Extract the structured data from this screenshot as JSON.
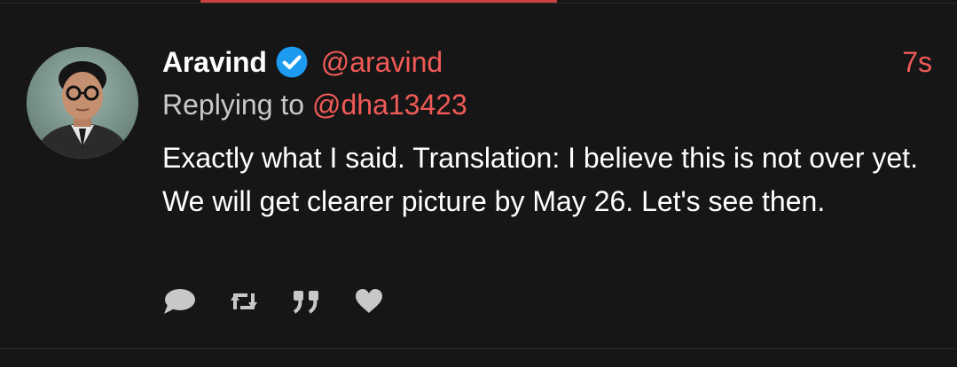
{
  "tweet": {
    "author_name": "Aravind",
    "handle": "@aravind",
    "time": "7s",
    "reply_prefix": "Replying to",
    "reply_handle": "@dha13423",
    "body_text": "Exactly what I said. Translation: I believe this is not over yet. We will get clearer picture by May 26. Let's see then."
  },
  "icons": {
    "verified": "verified-badge-icon",
    "reply": "speech-bubble-icon",
    "retweet": "retweet-icon",
    "quote": "quote-icon",
    "like": "heart-icon"
  },
  "colors": {
    "background": "#161616",
    "accent": "#f05a57",
    "verified": "#1d9bf0",
    "text": "#ffffff",
    "muted": "#c9c9c9",
    "icon": "#c8c8c8"
  }
}
